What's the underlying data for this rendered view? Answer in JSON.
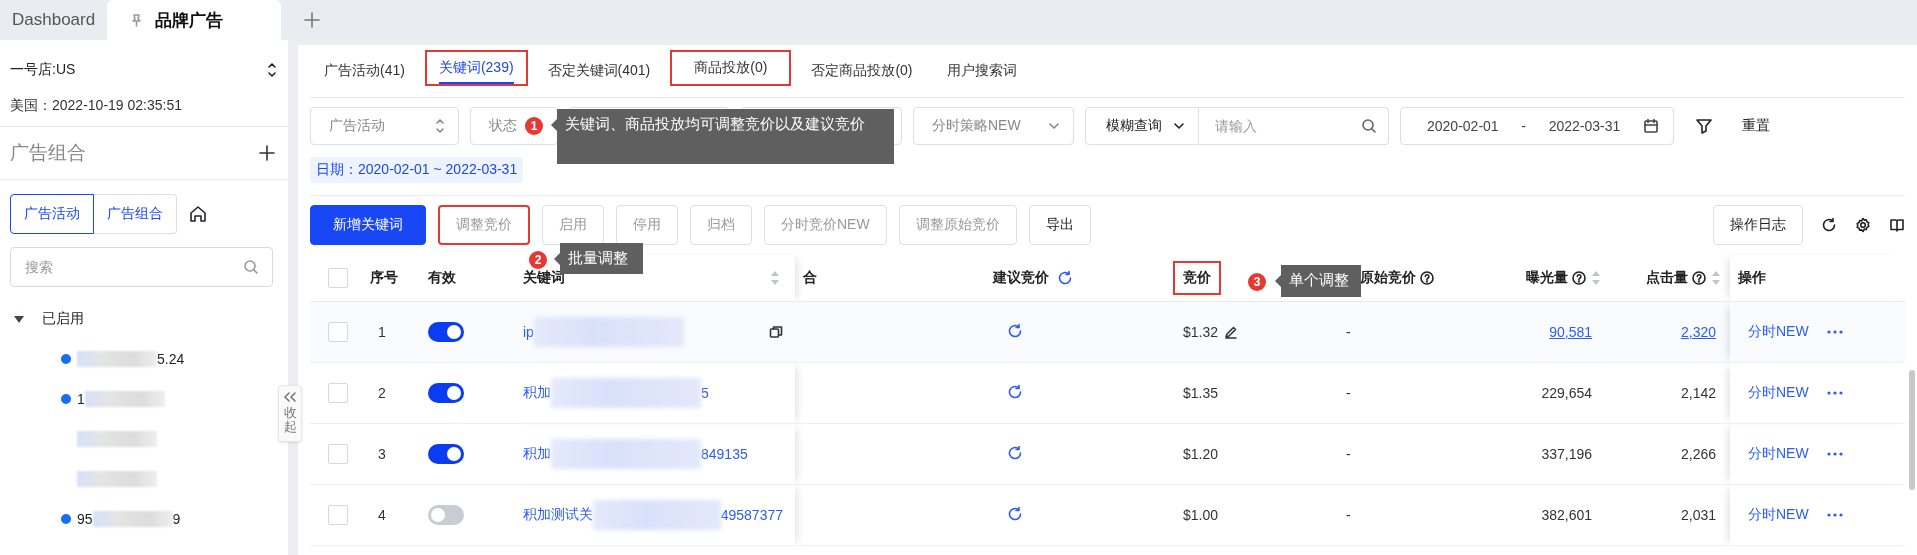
{
  "window_tabs": [
    {
      "label": "Dashboard",
      "selected": false,
      "pinned": false
    },
    {
      "label": "品牌广告",
      "selected": true,
      "pinned": true
    }
  ],
  "sidebar": {
    "store": "一号店:US",
    "time": "美国：2022-10-19 02:35:51",
    "section_title": "广告组合",
    "view_toggle": [
      {
        "label": "广告活动",
        "selected": true
      },
      {
        "label": "广告组合",
        "selected": false
      }
    ],
    "search": {
      "placeholder": "搜索"
    },
    "tree": [
      {
        "label": "已启用",
        "expanded": true,
        "children": [
          {
            "end": "5.24",
            "dot": true
          },
          {
            "start": "1",
            "dot": true
          },
          {
            "dot": false
          },
          {
            "dot": false
          },
          {
            "start": "95",
            "end": "9",
            "dot": true
          }
        ]
      }
    ],
    "collapse_label": "收起"
  },
  "tabs": [
    {
      "label": "广告活动(41)",
      "selected": false,
      "highlighted": false
    },
    {
      "label": "关键词(239)",
      "selected": true,
      "highlighted": true
    },
    {
      "label": "否定关键词(401)",
      "selected": false,
      "highlighted": false
    },
    {
      "label": "商品投放(0)",
      "selected": false,
      "highlighted": true
    },
    {
      "label": "否定商品投放(0)",
      "selected": false,
      "highlighted": false
    },
    {
      "label": "用户搜索词",
      "selected": false,
      "highlighted": false
    }
  ],
  "filters": [
    {
      "kind": "updown",
      "placeholder": "广告活动"
    },
    {
      "kind": "select",
      "placeholder": "状态"
    },
    {
      "kind": "select"
    },
    {
      "kind": "select"
    },
    {
      "kind": "select",
      "placeholder": "分时策略NEW"
    },
    {
      "kind": "search",
      "mode": "模糊查询",
      "placeholder": "请输入"
    },
    {
      "kind": "daterange",
      "start": "2020-02-01",
      "separator": "-",
      "end": "2022-03-31"
    }
  ],
  "reset": "重置",
  "date_tag": "日期：2020-02-01 ~ 2022-03-31",
  "toolbar": [
    {
      "label": "新增关键词",
      "kind": "primary",
      "disabled": false,
      "highlighted": false
    },
    {
      "label": "调整竞价",
      "kind": "plain",
      "disabled": true,
      "highlighted": true
    },
    {
      "label": "启用",
      "kind": "plain",
      "disabled": true,
      "highlighted": false
    },
    {
      "label": "停用",
      "kind": "plain",
      "disabled": true,
      "highlighted": false
    },
    {
      "label": "归档",
      "kind": "plain",
      "disabled": true,
      "highlighted": false
    },
    {
      "label": "分时竞价NEW",
      "kind": "plain",
      "disabled": true,
      "highlighted": false
    },
    {
      "label": "调整原始竞价",
      "kind": "plain",
      "disabled": true,
      "highlighted": false
    },
    {
      "label": "导出",
      "kind": "plain",
      "disabled": false,
      "highlighted": false
    }
  ],
  "log_button": "操作日志",
  "select_all_checked": false,
  "columns": [
    {
      "label": "序号",
      "kind": "plain",
      "highlighted": false
    },
    {
      "label": "有效",
      "kind": "plain",
      "highlighted": false
    },
    {
      "label": "关键词",
      "kind": "sort",
      "highlighted": false
    },
    {
      "label": "合",
      "kind": "plain",
      "highlighted": false
    },
    {
      "label": "建议竞价",
      "kind": "refresh",
      "highlighted": false
    },
    {
      "label": "竞价",
      "kind": "plain",
      "highlighted": true
    },
    {
      "label": "原始竞价",
      "kind": "help",
      "highlighted": false
    },
    {
      "label": "曝光量",
      "kind": "help_sort",
      "highlighted": false
    },
    {
      "label": "点击量",
      "kind": "help_sort",
      "highlighted": false
    },
    {
      "label": "操作",
      "kind": "plain",
      "highlighted": false
    }
  ],
  "rows": [
    {
      "no": "1",
      "checked": false,
      "enabled": true,
      "hovered": true,
      "keyword_start": "ip",
      "bid": "$1.32",
      "original_bid": "-",
      "impressions": "90,581",
      "clicks": "2,320",
      "action": "分时NEW"
    },
    {
      "no": "2",
      "checked": false,
      "enabled": true,
      "hovered": false,
      "keyword_start": "积加",
      "keyword_end": "5",
      "bid": "$1.35",
      "original_bid": "-",
      "impressions": "229,654",
      "clicks": "2,142",
      "action": "分时NEW"
    },
    {
      "no": "3",
      "checked": false,
      "enabled": true,
      "hovered": false,
      "keyword_start": "积加",
      "keyword_end": "849135",
      "bid": "$1.20",
      "original_bid": "-",
      "impressions": "337,196",
      "clicks": "2,266",
      "action": "分时NEW"
    },
    {
      "no": "4",
      "checked": false,
      "enabled": false,
      "hovered": false,
      "keyword_start": "积加测试关",
      "keyword_end": "49587377",
      "bid": "$1.00",
      "original_bid": "-",
      "impressions": "382,601",
      "clicks": "2,031",
      "action": "分时NEW"
    }
  ],
  "callouts": [
    {
      "number": "1",
      "text": "关键词、商品投放均可调整竞价以及建议竞价"
    },
    {
      "number": "2",
      "text": "批量调整"
    },
    {
      "number": "3",
      "text": "单个调整"
    }
  ]
}
